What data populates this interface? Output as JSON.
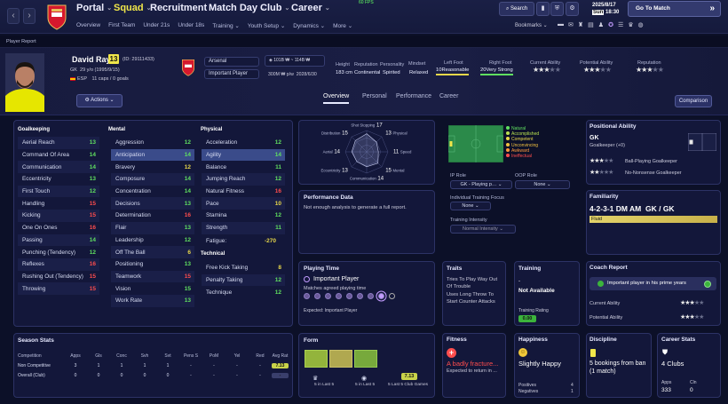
{
  "topbar": {
    "menu": [
      "Portal",
      "Squad",
      "Recruitment",
      "Match Day",
      "Club",
      "Career"
    ],
    "active": "Squad",
    "sub": [
      "Overview",
      "First Team",
      "Under 21s",
      "Under 18s",
      "Training",
      "Youth Setup",
      "Dynamics",
      "More"
    ],
    "fps": "60 FPS",
    "search": "Search",
    "date": "2025/8/17",
    "day": "Sun",
    "time": "18:30",
    "goto": "Go To Match",
    "bookmarks": "Bookmarks"
  },
  "crumb": "Player Report",
  "player": {
    "name": "David Raya",
    "number": "13",
    "id": "(ID: 29111433)",
    "pos": "GK",
    "age": "29 y/o (1995/9/15)",
    "nation": "ESP",
    "caps": "11 caps / 0 goals",
    "club": "Arsenal",
    "status": "Important Player",
    "value": "101B ₩ ~ 114B ₩",
    "wage": "300M ₩ p/w",
    "contract": "2028/6/30",
    "height_l": "Height",
    "height": "183 cm",
    "rep_l": "Reputation",
    "rep": "Continental",
    "pers_l": "Personality",
    "pers": "Spirited",
    "mind_l": "Mindset",
    "mind": "Relaxed",
    "lf_l": "Left Foot",
    "lf": "10Reasonable",
    "rf_l": "Right Foot",
    "rf": "20Very Strong",
    "ca_l": "Current Ability",
    "pa_l": "Potential Ability",
    "rep2_l": "Reputation",
    "actions": "Actions"
  },
  "tabs": [
    "Overview",
    "Personal",
    "Performance",
    "Career"
  ],
  "comparison": "Comparison",
  "attrs": {
    "gk_title": "Goalkeeping",
    "mental_title": "Mental",
    "phys_title": "Physical",
    "tech_title": "Technical",
    "gk": [
      [
        "Aerial Reach",
        "13",
        "g"
      ],
      [
        "Command Of Area",
        "14",
        "g"
      ],
      [
        "Communication",
        "14",
        "g"
      ],
      [
        "Eccentricity",
        "13",
        "g"
      ],
      [
        "First Touch",
        "12",
        "g"
      ],
      [
        "Handling",
        "15",
        "r"
      ],
      [
        "Kicking",
        "15",
        "r"
      ],
      [
        "One On Ones",
        "16",
        "r"
      ],
      [
        "Passing",
        "14",
        "g"
      ],
      [
        "Punching (Tendency)",
        "12",
        "g"
      ],
      [
        "Reflexes",
        "16",
        "r"
      ],
      [
        "Rushing Out (Tendency)",
        "15",
        "r"
      ],
      [
        "Throwing",
        "15",
        "r"
      ]
    ],
    "mental": [
      [
        "Aggression",
        "12",
        "g"
      ],
      [
        "Anticipation",
        "14",
        "g"
      ],
      [
        "Bravery",
        "12",
        "y"
      ],
      [
        "Composure",
        "14",
        "g"
      ],
      [
        "Concentration",
        "14",
        "g"
      ],
      [
        "Decisions",
        "13",
        "g"
      ],
      [
        "Determination",
        "16",
        "r"
      ],
      [
        "Flair",
        "13",
        "g"
      ],
      [
        "Leadership",
        "12",
        "g"
      ],
      [
        "Off The Ball",
        "6",
        "y"
      ],
      [
        "Positioning",
        "13",
        "g"
      ],
      [
        "Teamwork",
        "15",
        "r"
      ],
      [
        "Vision",
        "15",
        "g"
      ],
      [
        "Work Rate",
        "13",
        "g"
      ]
    ],
    "physical": [
      [
        "Acceleration",
        "12",
        "g"
      ],
      [
        "Agility",
        "14",
        "g"
      ],
      [
        "Balance",
        "11",
        "g"
      ],
      [
        "Jumping Reach",
        "12",
        "g"
      ],
      [
        "Natural Fitness",
        "16",
        "r"
      ],
      [
        "Pace",
        "10",
        "y"
      ],
      [
        "Stamina",
        "12",
        "g"
      ],
      [
        "Strength",
        "11",
        "g"
      ]
    ],
    "fatigue_l": "Fatigue:",
    "fatigue": "-270",
    "technical": [
      [
        "Free Kick Taking",
        "8",
        "y"
      ],
      [
        "Penalty Taking",
        "12",
        "g"
      ],
      [
        "Technique",
        "12",
        "g"
      ]
    ]
  },
  "radar": {
    "labels": [
      "Shot Stopping",
      "Physical",
      "Speed",
      "Mental",
      "Communication",
      "Eccentricity",
      "Aerial",
      "Distribution"
    ],
    "values": [
      17,
      13,
      11,
      15,
      14,
      13,
      14,
      15
    ]
  },
  "perfdata": {
    "title": "Performance Data",
    "text": "Not enough analysis to generate a full report."
  },
  "legend": [
    "Natural",
    "Accomplished",
    "Competent",
    "Unconvincing",
    "Awkward",
    "Ineffectual"
  ],
  "roles": {
    "ip_l": "IP Role",
    "ip": "GK - Playing p…",
    "oop_l": "OOP Role",
    "oop": "None",
    "tf_l": "Individual Training Focus",
    "tf": "None",
    "ti_l": "Training Intensity",
    "ti": "Normal Intensity"
  },
  "posab": {
    "title": "Positional Ability",
    "pos": "GK",
    "sub": "Goalkeeper (+0)",
    "r1": "Ball-Playing Goalkeeper",
    "r2": "No-Nonsense Goalkeeper"
  },
  "familiarity": {
    "title": "Familiarity",
    "formation": "4-2-3-1 DM AM",
    "pos": "GK / GK",
    "fluid": "Fluid"
  },
  "playtime": {
    "title": "Playing Time",
    "role": "Important Player",
    "matches": "Matches agreed playing time",
    "expected": "Expected: Important Player"
  },
  "traits": {
    "title": "Traits",
    "t1": "Tries To Play Way Out Of Trouble",
    "t2": "Uses Long Throw To Start Counter Attacks"
  },
  "training": {
    "title": "Training",
    "dash": "-",
    "na": "Not Available",
    "rating_l": "Training Rating",
    "rating": "0.00"
  },
  "coach": {
    "title": "Coach Report",
    "msg": "Important player in his prime years",
    "ca": "Current Ability",
    "pa": "Potential Ability"
  },
  "season": {
    "title": "Season Stats",
    "cols": [
      "Competition",
      "Apps",
      "Gls",
      "Conc",
      "Svh",
      "Svt",
      "Pens S",
      "PoM",
      "Yel",
      "Red",
      "Avg Rat"
    ],
    "rows": [
      [
        "Non Competitive",
        "3",
        "1",
        "1",
        "1",
        "1",
        "-",
        "-",
        "-",
        "-",
        "7.13"
      ],
      [
        "Overall (Club)",
        "0",
        "0",
        "0",
        "0",
        "0",
        "-",
        "-",
        "-",
        "-",
        "-"
      ]
    ]
  },
  "form": {
    "title": "Form",
    "l1": "5 in Last 5",
    "l2": "5 in Last 5",
    "l3": "5 Last 5 Club Games",
    "rating": "7.13"
  },
  "fitness": {
    "title": "Fitness",
    "status": "A badly fracture...",
    "ret": "Expected to return in ..."
  },
  "happiness": {
    "title": "Happiness",
    "status": "Slightly Happy",
    "pos_l": "Positives",
    "pos": "4",
    "neg_l": "Negatives",
    "neg": "1"
  },
  "discipline": {
    "title": "Discipline",
    "text": "5 bookings from ban (1 match)"
  },
  "career": {
    "title": "Career Stats",
    "clubs": "4 Clubs",
    "apps_l": "Apps",
    "apps": "333",
    "cln_l": "Cln",
    "cln": "0"
  },
  "colors": {
    "bg": "#0c1028",
    "panel": "#13173a",
    "green": "#60e060",
    "red": "#ff4d4d",
    "yellow": "#e8d84a",
    "arsenal": "#d5182d"
  }
}
